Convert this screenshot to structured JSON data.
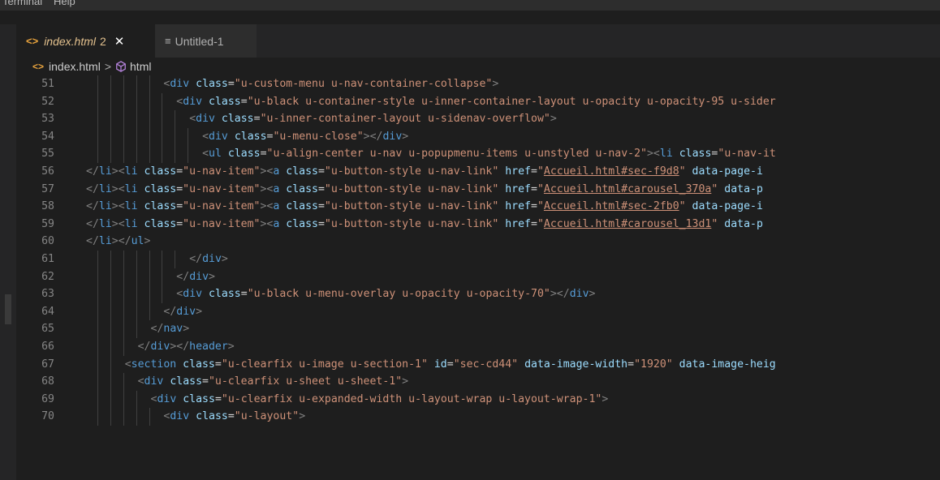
{
  "menubar": {
    "items": [
      "Terminal",
      "Help"
    ]
  },
  "tabs": [
    {
      "icon": "<>",
      "label": "index.html",
      "badge": "2",
      "close": "✕",
      "active": true
    },
    {
      "icon": "≡",
      "label": "Untitled-1",
      "active": false
    }
  ],
  "breadcrumb": {
    "file": "index.html",
    "separator": ">",
    "symbol": "html"
  },
  "editor": {
    "lines": [
      {
        "num": "51",
        "indent": 6,
        "tokens": [
          [
            "punc",
            "<"
          ],
          [
            "tag",
            "div"
          ],
          [
            "txt",
            " "
          ],
          [
            "attr",
            "class"
          ],
          [
            "txt",
            "="
          ],
          [
            "str",
            "\"u-custom-menu u-nav-container-collapse\""
          ],
          [
            "punc",
            ">"
          ]
        ]
      },
      {
        "num": "52",
        "indent": 7,
        "tokens": [
          [
            "punc",
            "<"
          ],
          [
            "tag",
            "div"
          ],
          [
            "txt",
            " "
          ],
          [
            "attr",
            "class"
          ],
          [
            "txt",
            "="
          ],
          [
            "str",
            "\"u-black u-container-style u-inner-container-layout u-opacity u-opacity-95 u-sider"
          ]
        ]
      },
      {
        "num": "53",
        "indent": 8,
        "tokens": [
          [
            "punc",
            "<"
          ],
          [
            "tag",
            "div"
          ],
          [
            "txt",
            " "
          ],
          [
            "attr",
            "class"
          ],
          [
            "txt",
            "="
          ],
          [
            "str",
            "\"u-inner-container-layout u-sidenav-overflow\""
          ],
          [
            "punc",
            ">"
          ]
        ]
      },
      {
        "num": "54",
        "indent": 9,
        "tokens": [
          [
            "punc",
            "<"
          ],
          [
            "tag",
            "div"
          ],
          [
            "txt",
            " "
          ],
          [
            "attr",
            "class"
          ],
          [
            "txt",
            "="
          ],
          [
            "str",
            "\"u-menu-close\""
          ],
          [
            "punc",
            "></"
          ],
          [
            "tag",
            "div"
          ],
          [
            "punc",
            ">"
          ]
        ]
      },
      {
        "num": "55",
        "indent": 9,
        "tokens": [
          [
            "punc",
            "<"
          ],
          [
            "tag",
            "ul"
          ],
          [
            "txt",
            " "
          ],
          [
            "attr",
            "class"
          ],
          [
            "txt",
            "="
          ],
          [
            "str",
            "\"u-align-center u-nav u-popupmenu-items u-unstyled u-nav-2\""
          ],
          [
            "punc",
            "><"
          ],
          [
            "tag",
            "li"
          ],
          [
            "txt",
            " "
          ],
          [
            "attr",
            "class"
          ],
          [
            "txt",
            "="
          ],
          [
            "str",
            "\"u-nav-it"
          ]
        ]
      },
      {
        "num": "56",
        "indent": 0,
        "tokens": [
          [
            "punc",
            "</"
          ],
          [
            "tag",
            "li"
          ],
          [
            "punc",
            "><"
          ],
          [
            "tag",
            "li"
          ],
          [
            "txt",
            " "
          ],
          [
            "attr",
            "class"
          ],
          [
            "txt",
            "="
          ],
          [
            "str",
            "\"u-nav-item\""
          ],
          [
            "punc",
            "><"
          ],
          [
            "tag",
            "a"
          ],
          [
            "txt",
            " "
          ],
          [
            "attr",
            "class"
          ],
          [
            "txt",
            "="
          ],
          [
            "str",
            "\"u-button-style u-nav-link\""
          ],
          [
            "txt",
            " "
          ],
          [
            "attr",
            "href"
          ],
          [
            "txt",
            "="
          ],
          [
            "str",
            "\""
          ],
          [
            "link",
            "Accueil.html#sec-f9d8"
          ],
          [
            "str",
            "\""
          ],
          [
            "txt",
            " "
          ],
          [
            "attr",
            "data-page-i"
          ]
        ]
      },
      {
        "num": "57",
        "indent": 0,
        "tokens": [
          [
            "punc",
            "</"
          ],
          [
            "tag",
            "li"
          ],
          [
            "punc",
            "><"
          ],
          [
            "tag",
            "li"
          ],
          [
            "txt",
            " "
          ],
          [
            "attr",
            "class"
          ],
          [
            "txt",
            "="
          ],
          [
            "str",
            "\"u-nav-item\""
          ],
          [
            "punc",
            "><"
          ],
          [
            "tag",
            "a"
          ],
          [
            "txt",
            " "
          ],
          [
            "attr",
            "class"
          ],
          [
            "txt",
            "="
          ],
          [
            "str",
            "\"u-button-style u-nav-link\""
          ],
          [
            "txt",
            " "
          ],
          [
            "attr",
            "href"
          ],
          [
            "txt",
            "="
          ],
          [
            "str",
            "\""
          ],
          [
            "link",
            "Accueil.html#carousel_370a"
          ],
          [
            "str",
            "\""
          ],
          [
            "txt",
            " "
          ],
          [
            "attr",
            "data-p"
          ]
        ]
      },
      {
        "num": "58",
        "indent": 0,
        "tokens": [
          [
            "punc",
            "</"
          ],
          [
            "tag",
            "li"
          ],
          [
            "punc",
            "><"
          ],
          [
            "tag",
            "li"
          ],
          [
            "txt",
            " "
          ],
          [
            "attr",
            "class"
          ],
          [
            "txt",
            "="
          ],
          [
            "str",
            "\"u-nav-item\""
          ],
          [
            "punc",
            "><"
          ],
          [
            "tag",
            "a"
          ],
          [
            "txt",
            " "
          ],
          [
            "attr",
            "class"
          ],
          [
            "txt",
            "="
          ],
          [
            "str",
            "\"u-button-style u-nav-link\""
          ],
          [
            "txt",
            " "
          ],
          [
            "attr",
            "href"
          ],
          [
            "txt",
            "="
          ],
          [
            "str",
            "\""
          ],
          [
            "link",
            "Accueil.html#sec-2fb0"
          ],
          [
            "str",
            "\""
          ],
          [
            "txt",
            " "
          ],
          [
            "attr",
            "data-page-i"
          ]
        ]
      },
      {
        "num": "59",
        "indent": 0,
        "tokens": [
          [
            "punc",
            "</"
          ],
          [
            "tag",
            "li"
          ],
          [
            "punc",
            "><"
          ],
          [
            "tag",
            "li"
          ],
          [
            "txt",
            " "
          ],
          [
            "attr",
            "class"
          ],
          [
            "txt",
            "="
          ],
          [
            "str",
            "\"u-nav-item\""
          ],
          [
            "punc",
            "><"
          ],
          [
            "tag",
            "a"
          ],
          [
            "txt",
            " "
          ],
          [
            "attr",
            "class"
          ],
          [
            "txt",
            "="
          ],
          [
            "str",
            "\"u-button-style u-nav-link\""
          ],
          [
            "txt",
            " "
          ],
          [
            "attr",
            "href"
          ],
          [
            "txt",
            "="
          ],
          [
            "str",
            "\""
          ],
          [
            "link",
            "Accueil.html#carousel_13d1"
          ],
          [
            "str",
            "\""
          ],
          [
            "txt",
            " "
          ],
          [
            "attr",
            "data-p"
          ]
        ]
      },
      {
        "num": "60",
        "indent": 0,
        "tokens": [
          [
            "punc",
            "</"
          ],
          [
            "tag",
            "li"
          ],
          [
            "punc",
            "></"
          ],
          [
            "tag",
            "ul"
          ],
          [
            "punc",
            ">"
          ]
        ]
      },
      {
        "num": "61",
        "indent": 8,
        "tokens": [
          [
            "punc",
            "</"
          ],
          [
            "tag",
            "div"
          ],
          [
            "punc",
            ">"
          ]
        ]
      },
      {
        "num": "62",
        "indent": 7,
        "tokens": [
          [
            "punc",
            "</"
          ],
          [
            "tag",
            "div"
          ],
          [
            "punc",
            ">"
          ]
        ]
      },
      {
        "num": "63",
        "indent": 7,
        "tokens": [
          [
            "punc",
            "<"
          ],
          [
            "tag",
            "div"
          ],
          [
            "txt",
            " "
          ],
          [
            "attr",
            "class"
          ],
          [
            "txt",
            "="
          ],
          [
            "str",
            "\"u-black u-menu-overlay u-opacity u-opacity-70\""
          ],
          [
            "punc",
            "></"
          ],
          [
            "tag",
            "div"
          ],
          [
            "punc",
            ">"
          ]
        ]
      },
      {
        "num": "64",
        "indent": 6,
        "tokens": [
          [
            "punc",
            "</"
          ],
          [
            "tag",
            "div"
          ],
          [
            "punc",
            ">"
          ]
        ]
      },
      {
        "num": "65",
        "indent": 5,
        "tokens": [
          [
            "punc",
            "</"
          ],
          [
            "tag",
            "nav"
          ],
          [
            "punc",
            ">"
          ]
        ]
      },
      {
        "num": "66",
        "indent": 4,
        "tokens": [
          [
            "punc",
            "</"
          ],
          [
            "tag",
            "div"
          ],
          [
            "punc",
            "></"
          ],
          [
            "tag",
            "header"
          ],
          [
            "punc",
            ">"
          ]
        ]
      },
      {
        "num": "67",
        "indent": 3,
        "tokens": [
          [
            "punc",
            "<"
          ],
          [
            "tag",
            "section"
          ],
          [
            "txt",
            " "
          ],
          [
            "attr",
            "class"
          ],
          [
            "txt",
            "="
          ],
          [
            "str",
            "\"u-clearfix u-image u-section-1\""
          ],
          [
            "txt",
            " "
          ],
          [
            "attr",
            "id"
          ],
          [
            "txt",
            "="
          ],
          [
            "str",
            "\"sec-cd44\""
          ],
          [
            "txt",
            " "
          ],
          [
            "attr",
            "data-image-width"
          ],
          [
            "txt",
            "="
          ],
          [
            "str",
            "\"1920\""
          ],
          [
            "txt",
            " "
          ],
          [
            "attr",
            "data-image-heig"
          ]
        ]
      },
      {
        "num": "68",
        "indent": 4,
        "tokens": [
          [
            "punc",
            "<"
          ],
          [
            "tag",
            "div"
          ],
          [
            "txt",
            " "
          ],
          [
            "attr",
            "class"
          ],
          [
            "txt",
            "="
          ],
          [
            "str",
            "\"u-clearfix u-sheet u-sheet-1\""
          ],
          [
            "punc",
            ">"
          ]
        ]
      },
      {
        "num": "69",
        "indent": 5,
        "tokens": [
          [
            "punc",
            "<"
          ],
          [
            "tag",
            "div"
          ],
          [
            "txt",
            " "
          ],
          [
            "attr",
            "class"
          ],
          [
            "txt",
            "="
          ],
          [
            "str",
            "\"u-clearfix u-expanded-width u-layout-wrap u-layout-wrap-1\""
          ],
          [
            "punc",
            ">"
          ]
        ]
      },
      {
        "num": "70",
        "indent": 6,
        "tokens": [
          [
            "punc",
            "<"
          ],
          [
            "tag",
            "div"
          ],
          [
            "txt",
            " "
          ],
          [
            "attr",
            "class"
          ],
          [
            "txt",
            "="
          ],
          [
            "str",
            "\"u-layout\""
          ],
          [
            "punc",
            ">"
          ]
        ]
      }
    ]
  }
}
